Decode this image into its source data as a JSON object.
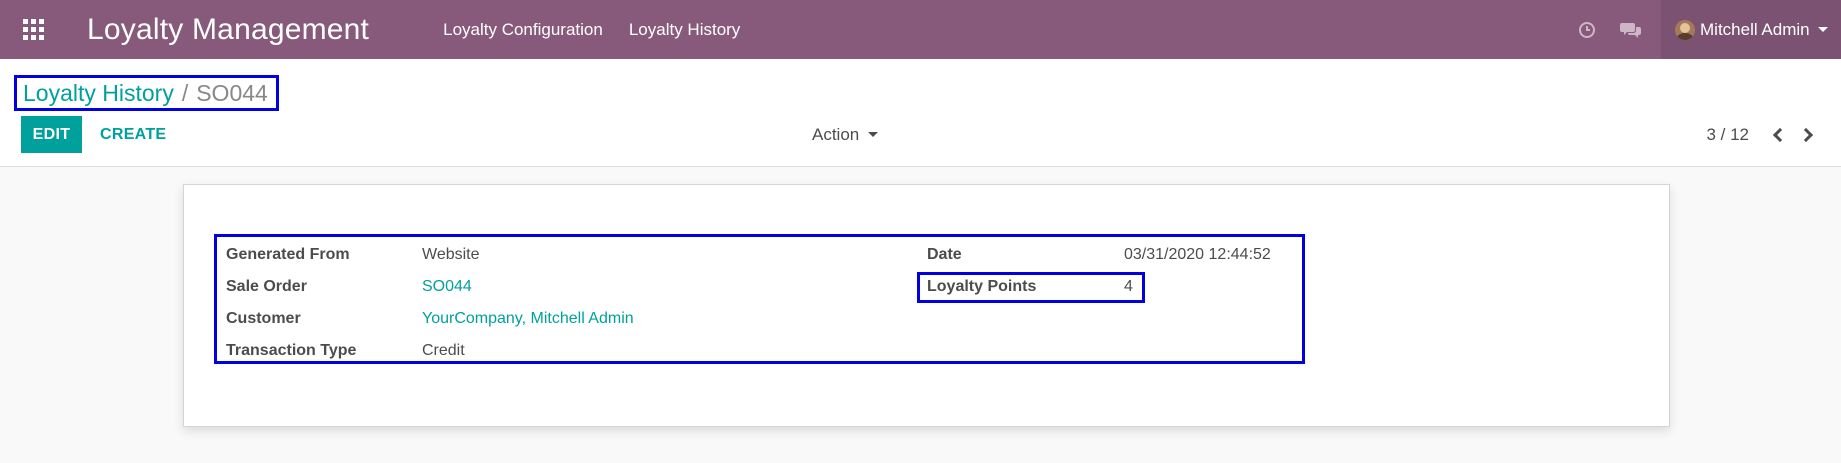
{
  "navbar": {
    "brand": "Loyalty Management",
    "menu": [
      "Loyalty Configuration",
      "Loyalty History"
    ],
    "user": "Mitchell Admin",
    "icons": [
      "apps-grid-icon",
      "clock-icon",
      "chat-icon"
    ],
    "color": "#875a7b"
  },
  "breadcrumb": {
    "parent": "Loyalty History",
    "separator": "/",
    "current": "SO044"
  },
  "toolbar": {
    "edit_label": "EDIT",
    "create_label": "CREATE",
    "action_label": "Action"
  },
  "pager": {
    "value": "3 / 12"
  },
  "form": {
    "left": [
      {
        "label": "Generated From",
        "value": "Website",
        "link": false
      },
      {
        "label": "Sale Order",
        "value": "SO044",
        "link": true
      },
      {
        "label": "Customer",
        "value": "YourCompany, Mitchell Admin",
        "link": true
      },
      {
        "label": "Transaction Type",
        "value": "Credit",
        "link": false
      }
    ],
    "right": [
      {
        "label": "Date",
        "value": "03/31/2020 12:44:52"
      },
      {
        "label": "Loyalty Points",
        "value": "4"
      }
    ]
  },
  "colors": {
    "accent": "#00a09d",
    "highlight_border": "#0000e0"
  }
}
